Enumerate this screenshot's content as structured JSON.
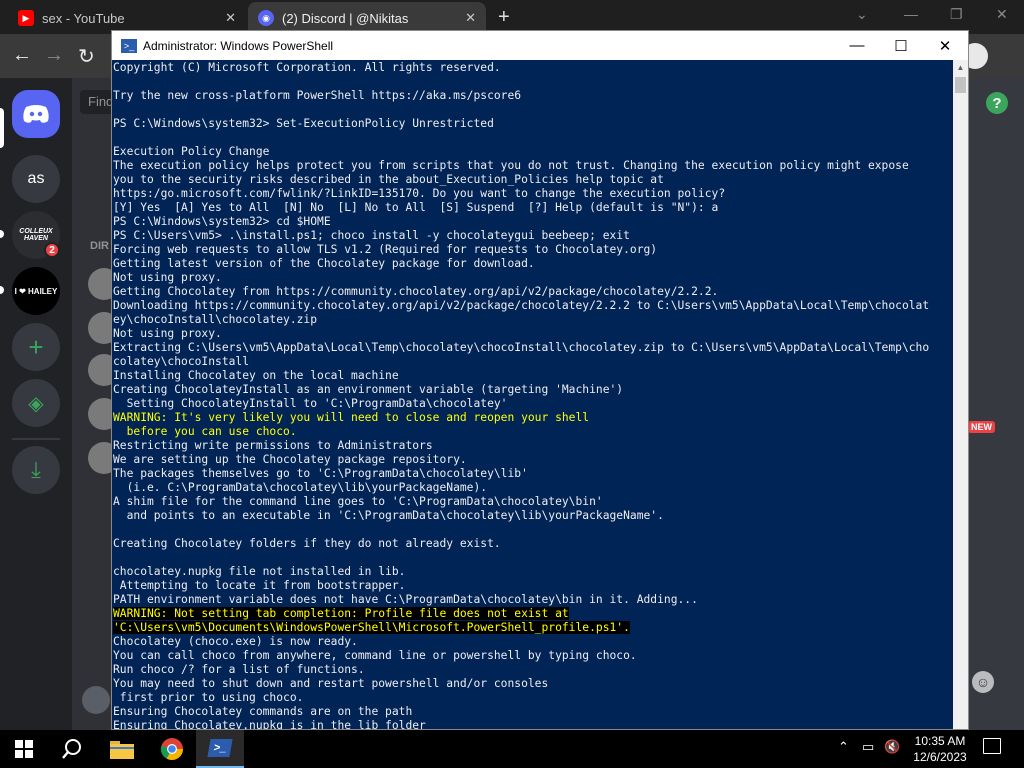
{
  "browser": {
    "tabs": [
      {
        "title": "sex - YouTube",
        "close": "✕"
      },
      {
        "title": "(2) Discord | @Nikitas",
        "close": "✕"
      }
    ],
    "new_tab": "+",
    "window_controls": [
      "⌄",
      "—",
      "❐",
      "✕"
    ]
  },
  "discord": {
    "find_placeholder": "Find",
    "guilds": [
      {
        "label": "as"
      },
      {
        "label": "COLLEUX HAVEN",
        "badge": "2"
      },
      {
        "label": "I ❤ HAILEY"
      }
    ],
    "directory_label": "DIR",
    "new_badge": "NEW",
    "help_glyph": "?"
  },
  "powershell": {
    "title": "Administrator: Windows PowerShell",
    "controls": {
      "minimize": "—",
      "maximize": "☐",
      "close": "✕"
    },
    "lines": [
      {
        "t": "Copyright (C) Microsoft Corporation. All rights reserved."
      },
      {
        "t": ""
      },
      {
        "t": "Try the new cross-platform PowerShell https://aka.ms/pscore6"
      },
      {
        "t": ""
      },
      {
        "t": "PS C:\\Windows\\system32> Set-ExecutionPolicy Unrestricted"
      },
      {
        "t": ""
      },
      {
        "t": "Execution Policy Change"
      },
      {
        "t": "The execution policy helps protect you from scripts that you do not trust. Changing the execution policy might expose"
      },
      {
        "t": "you to the security risks described in the about_Execution_Policies help topic at"
      },
      {
        "t": "https:/go.microsoft.com/fwlink/?LinkID=135170. Do you want to change the execution policy?"
      },
      {
        "t": "[Y] Yes  [A] Yes to All  [N] No  [L] No to All  [S] Suspend  [?] Help (default is \"N\"): a"
      },
      {
        "t": "PS C:\\Windows\\system32> cd $HOME"
      },
      {
        "t": "PS C:\\Users\\vm5> .\\install.ps1; choco install -y chocolateygui beebeep; exit"
      },
      {
        "t": "Forcing web requests to allow TLS v1.2 (Required for requests to Chocolatey.org)"
      },
      {
        "t": "Getting latest version of the Chocolatey package for download."
      },
      {
        "t": "Not using proxy."
      },
      {
        "t": "Getting Chocolatey from https://community.chocolatey.org/api/v2/package/chocolatey/2.2.2."
      },
      {
        "t": "Downloading https://community.chocolatey.org/api/v2/package/chocolatey/2.2.2 to C:\\Users\\vm5\\AppData\\Local\\Temp\\chocolat"
      },
      {
        "t": "ey\\chocoInstall\\chocolatey.zip"
      },
      {
        "t": "Not using proxy."
      },
      {
        "t": "Extracting C:\\Users\\vm5\\AppData\\Local\\Temp\\chocolatey\\chocoInstall\\chocolatey.zip to C:\\Users\\vm5\\AppData\\Local\\Temp\\cho"
      },
      {
        "t": "colatey\\chocoInstall"
      },
      {
        "t": "Installing Chocolatey on the local machine"
      },
      {
        "t": "Creating ChocolateyInstall as an environment variable (targeting 'Machine')"
      },
      {
        "t": "  Setting ChocolateyInstall to 'C:\\ProgramData\\chocolatey'"
      },
      {
        "t": "WARNING: It's very likely you will need to close and reopen your shell",
        "style": "warn"
      },
      {
        "t": "  before you can use choco.",
        "style": "warn"
      },
      {
        "t": "Restricting write permissions to Administrators"
      },
      {
        "t": "We are setting up the Chocolatey package repository."
      },
      {
        "t": "The packages themselves go to 'C:\\ProgramData\\chocolatey\\lib'"
      },
      {
        "t": "  (i.e. C:\\ProgramData\\chocolatey\\lib\\yourPackageName)."
      },
      {
        "t": "A shim file for the command line goes to 'C:\\ProgramData\\chocolatey\\bin'"
      },
      {
        "t": "  and points to an executable in 'C:\\ProgramData\\chocolatey\\lib\\yourPackageName'."
      },
      {
        "t": ""
      },
      {
        "t": "Creating Chocolatey folders if they do not already exist."
      },
      {
        "t": ""
      },
      {
        "t": "chocolatey.nupkg file not installed in lib."
      },
      {
        "t": " Attempting to locate it from bootstrapper."
      },
      {
        "t": "PATH environment variable does not have C:\\ProgramData\\chocolatey\\bin in it. Adding..."
      },
      {
        "t": "WARNING: Not setting tab completion: Profile file does not exist at",
        "style": "warnbg"
      },
      {
        "t": "'C:\\Users\\vm5\\Documents\\WindowsPowerShell\\Microsoft.PowerShell_profile.ps1'.",
        "style": "warnbg"
      },
      {
        "t": "Chocolatey (choco.exe) is now ready."
      },
      {
        "t": "You can call choco from anywhere, command line or powershell by typing choco."
      },
      {
        "t": "Run choco /? for a list of functions."
      },
      {
        "t": "You may need to shut down and restart powershell and/or consoles"
      },
      {
        "t": " first prior to using choco."
      },
      {
        "t": "Ensuring Chocolatey commands are on the path"
      },
      {
        "t": "Ensuring Chocolatey.nupkg is in the lib folder"
      }
    ]
  },
  "taskbar": {
    "time": "10:35 AM",
    "date": "12/6/2023",
    "accent": "#76b9ed"
  },
  "colors": {
    "ps_background": "#012456",
    "ps_text": "#eeedf0",
    "warning": "#ffff00",
    "discord_accent": "#5865f2",
    "discord_green": "#3ba55d"
  }
}
